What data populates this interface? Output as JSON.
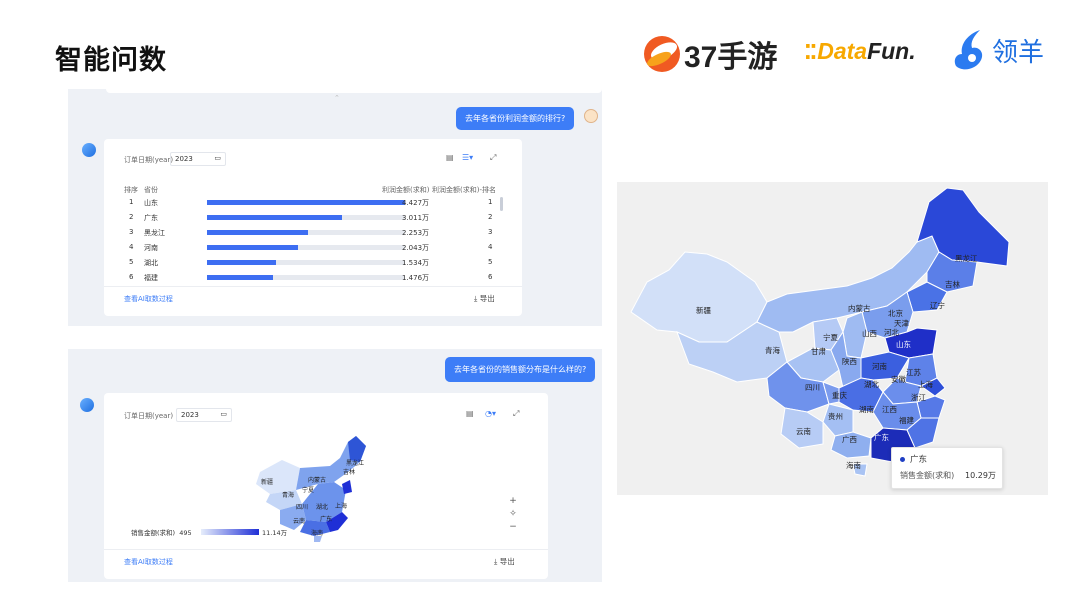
{
  "page_title": "智能问数",
  "logos": {
    "l37": "37手游",
    "datafun_a": "Data",
    "datafun_b": "Fun.",
    "lingyang": "领羊"
  },
  "chat1": {
    "question": "去年各省份利润金额的排行?",
    "filter_label": "订单日期(year)",
    "year": "2023",
    "headers": {
      "rank": "排序",
      "province": "省份",
      "amount": "利润金额(求和)",
      "rank_col": "利润金额(求和)-排名"
    },
    "rows": [
      {
        "rank": "1",
        "province": "山东",
        "amount": "4.427万",
        "r": "1",
        "frac": 1.0
      },
      {
        "rank": "2",
        "province": "广东",
        "amount": "3.011万",
        "r": "2",
        "frac": 0.68
      },
      {
        "rank": "3",
        "province": "黑龙江",
        "amount": "2.253万",
        "r": "3",
        "frac": 0.509
      },
      {
        "rank": "4",
        "province": "河南",
        "amount": "2.043万",
        "r": "4",
        "frac": 0.461
      },
      {
        "rank": "5",
        "province": "湖北",
        "amount": "1.534万",
        "r": "5",
        "frac": 0.347
      },
      {
        "rank": "6",
        "province": "福建",
        "amount": "1.476万",
        "r": "6",
        "frac": 0.333
      }
    ],
    "view_process": "查看AI取数过程",
    "export": "导出"
  },
  "chat2": {
    "question": "去年各省份的销售额分布是什么样的?",
    "filter_label": "订单日期(year)",
    "year": "2023",
    "legend_label": "销售金额(求和)",
    "legend_min": "495",
    "legend_max": "11.14万",
    "view_process": "查看AI取数过程",
    "export": "导出",
    "map_labels": [
      "新疆",
      "青海",
      "宁夏",
      "内蒙古",
      "吉林",
      "黑龙江",
      "四川",
      "湖北",
      "上海",
      "云南",
      "海南",
      "广东"
    ]
  },
  "bigmap": {
    "labels": [
      "新疆",
      "内蒙古",
      "黑龙江",
      "吉林",
      "辽宁",
      "北京",
      "天津",
      "河北",
      "山西",
      "宁夏",
      "甘肃",
      "青海",
      "陕西",
      "河南",
      "山东",
      "江苏",
      "安徽",
      "上海",
      "湖北",
      "四川",
      "重庆",
      "浙江",
      "湖南",
      "江西",
      "贵州",
      "福建",
      "云南",
      "广西",
      "广东",
      "海南"
    ],
    "tooltip": {
      "province": "广东",
      "metric": "销售金额(求和)",
      "value": "10.29万"
    }
  },
  "colors": {
    "accent": "#3d7df7",
    "bar": "#3d6ef2",
    "dark": "#1f2fd6"
  }
}
